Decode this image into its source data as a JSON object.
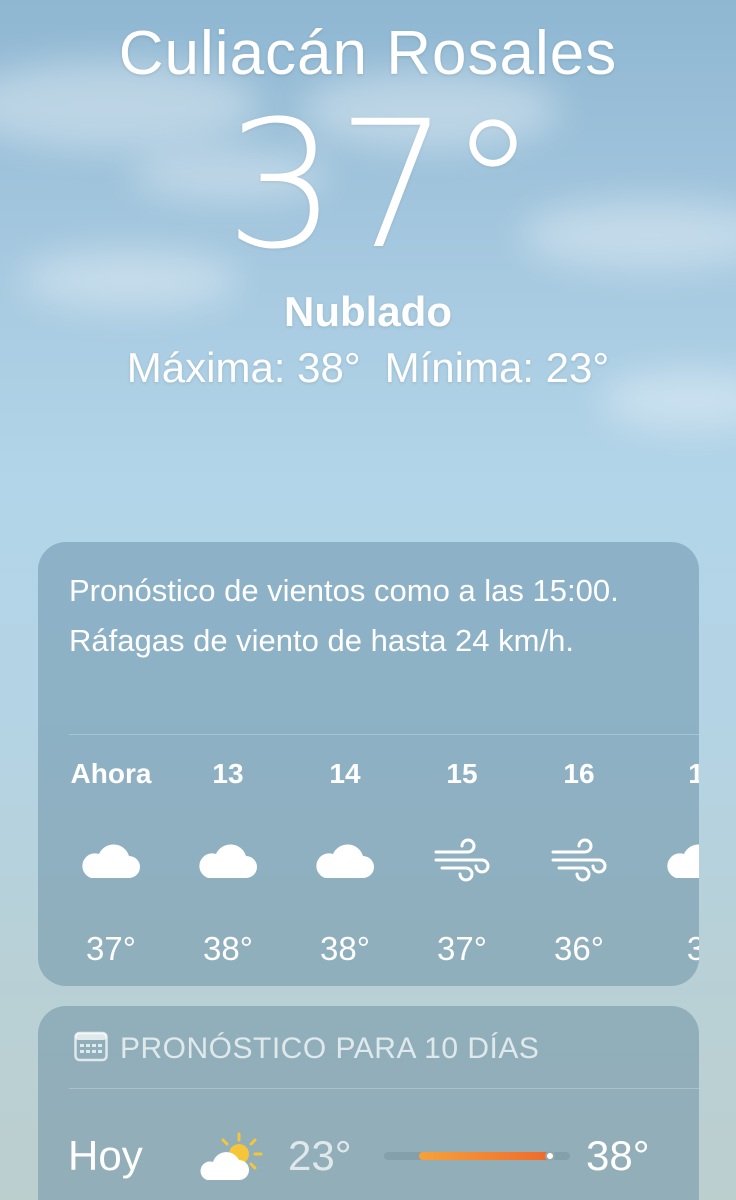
{
  "location": {
    "city": "Culiacán Rosales",
    "temperature": "37°",
    "condition": "Nublado",
    "high": "Máxima: 38°",
    "low": "Mínima: 23°"
  },
  "hourly": {
    "summary": "Pronóstico de vientos como a las 15:00. Ráfagas de viento de hasta 24 km/h.",
    "items": [
      {
        "label": "Ahora",
        "icon": "cloud-icon",
        "temp": "37°"
      },
      {
        "label": "13",
        "icon": "cloud-icon",
        "temp": "38°"
      },
      {
        "label": "14",
        "icon": "cloud-icon",
        "temp": "38°"
      },
      {
        "label": "15",
        "icon": "wind-icon",
        "temp": "37°"
      },
      {
        "label": "16",
        "icon": "wind-icon",
        "temp": "36°"
      },
      {
        "label": "1",
        "icon": "cloud-icon",
        "temp": "3"
      }
    ]
  },
  "daily": {
    "title": "PRONÓSTICO PARA 10 DÍAS",
    "days": [
      {
        "name": "Hoy",
        "icon": "partly-cloudy-sun-icon",
        "low": "23°",
        "high": "38°",
        "range_start": 0.19,
        "range_end": 0.89,
        "current": 0.89
      }
    ]
  },
  "colors": {
    "bar_start": "#f7a13a",
    "bar_end": "#f06a2a"
  }
}
